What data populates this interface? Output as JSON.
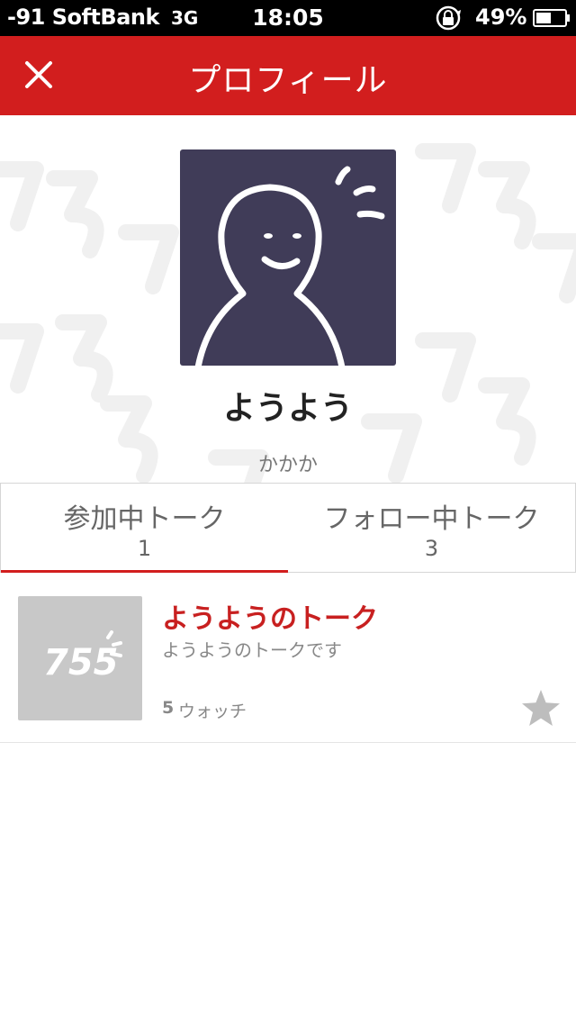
{
  "status_bar": {
    "carrier": "-91 SoftBank",
    "network": "3G",
    "time": "18:05",
    "battery": "49%",
    "lock_icon": "rotation-lock-icon",
    "battery_icon": "battery-icon"
  },
  "nav": {
    "title": "プロフィール",
    "close_icon": "close-icon"
  },
  "profile": {
    "username": "ようよう",
    "user_id": "かかか"
  },
  "tabs": [
    {
      "label": "参加中トーク",
      "count": "1",
      "active": true
    },
    {
      "label": "フォロー中トーク",
      "count": "3",
      "active": false
    }
  ],
  "talks": [
    {
      "title": "ようようのトーク",
      "description": "ようようのトークです",
      "watch_count": "5",
      "watch_label": "ウォッチ",
      "thumbnail_text": "755",
      "star_icon": "star-icon"
    }
  ],
  "colors": {
    "brand_red": "#d21e1e",
    "avatar_bg": "#403c58",
    "thumb_bg": "#c8c8c8"
  }
}
